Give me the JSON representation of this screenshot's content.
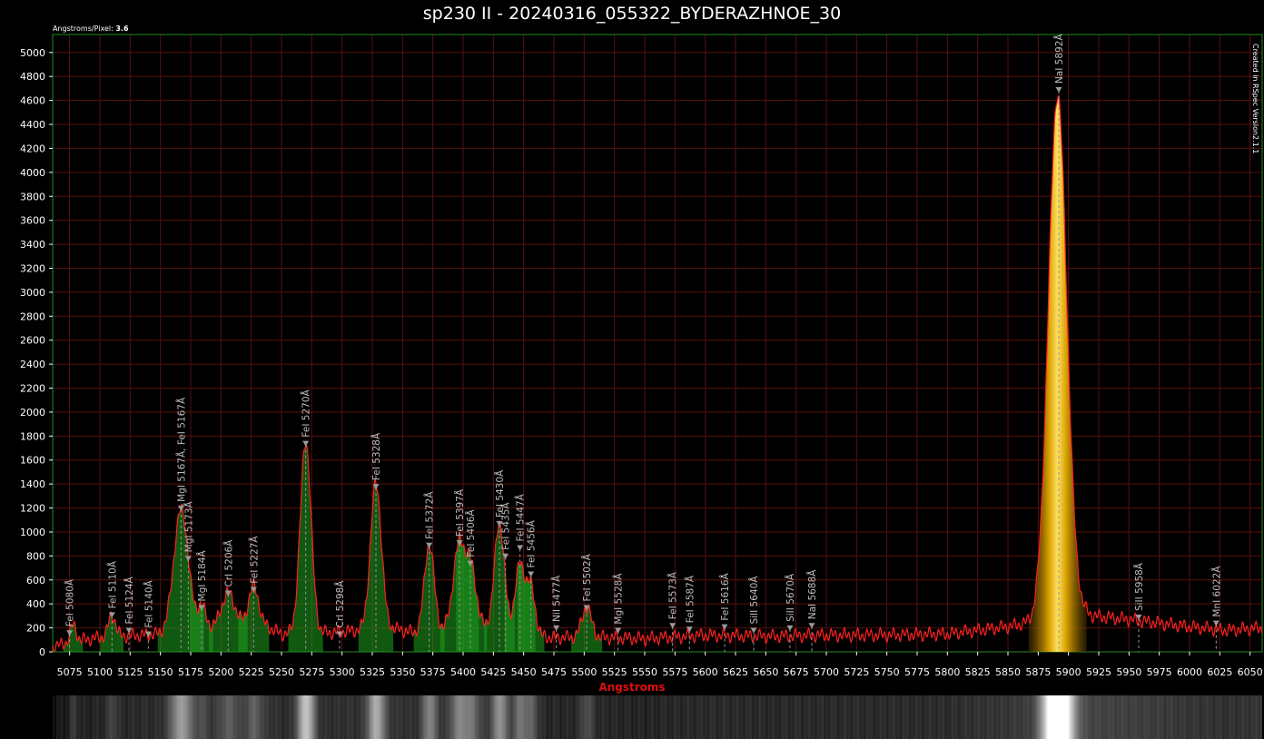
{
  "window": {
    "angstroms_per_pixel_label": "Angstroms/Pixel:",
    "angstroms_per_pixel_value": "3.6",
    "credit": "Created in RSpec Version2.1.1"
  },
  "colors": {
    "background": "#000000",
    "grid": "#5a1010",
    "plot_border": "#1f8a1f",
    "spectrum_line": "#ff2020",
    "peak_fill": "#1fa01f",
    "sodium_fill": "#f0c000",
    "axis_title": "#e01010",
    "marker": "#9a9a9a"
  },
  "chart_data": {
    "type": "line",
    "title": "sp230 II - 20240316_055322_BYDERAZHNOE_30",
    "xlabel": "Angstroms",
    "ylabel": "",
    "xlim": [
      5061,
      6060
    ],
    "ylim": [
      0,
      5150
    ],
    "grid": true,
    "x_ticks": [
      5075,
      5100,
      5125,
      5150,
      5175,
      5200,
      5225,
      5250,
      5275,
      5300,
      5325,
      5350,
      5375,
      5400,
      5425,
      5450,
      5475,
      5500,
      5525,
      5550,
      5575,
      5600,
      5625,
      5650,
      5675,
      5700,
      5725,
      5750,
      5775,
      5800,
      5825,
      5850,
      5875,
      5900,
      5925,
      5950,
      5975,
      6000,
      6025,
      6050
    ],
    "y_ticks": [
      0,
      200,
      400,
      600,
      800,
      1000,
      1200,
      1400,
      1600,
      1800,
      2000,
      2200,
      2400,
      2600,
      2800,
      3000,
      3200,
      3400,
      3600,
      3800,
      4000,
      4200,
      4400,
      4600,
      4800,
      5000
    ],
    "baseline": [
      [
        5061,
        40
      ],
      [
        5075,
        80
      ],
      [
        5100,
        120
      ],
      [
        5150,
        150
      ],
      [
        5200,
        230
      ],
      [
        5230,
        250
      ],
      [
        5250,
        150
      ],
      [
        5290,
        160
      ],
      [
        5340,
        200
      ],
      [
        5360,
        160
      ],
      [
        5420,
        220
      ],
      [
        5470,
        120
      ],
      [
        5520,
        120
      ],
      [
        5550,
        110
      ],
      [
        5600,
        140
      ],
      [
        5650,
        130
      ],
      [
        5700,
        140
      ],
      [
        5750,
        140
      ],
      [
        5800,
        150
      ],
      [
        5850,
        210
      ],
      [
        5870,
        250
      ],
      [
        5880,
        350
      ],
      [
        5900,
        400
      ],
      [
        5920,
        300
      ],
      [
        5950,
        270
      ],
      [
        5975,
        240
      ],
      [
        6000,
        210
      ],
      [
        6030,
        180
      ],
      [
        6060,
        200
      ]
    ],
    "peaks": [
      {
        "x": 5078,
        "y": 140,
        "w": 2.5
      },
      {
        "x": 5110,
        "y": 180,
        "w": 3
      },
      {
        "x": 5167,
        "y": 1010,
        "w": 6
      },
      {
        "x": 5184,
        "y": 180,
        "w": 3
      },
      {
        "x": 5206,
        "y": 260,
        "w": 5
      },
      {
        "x": 5227,
        "y": 300,
        "w": 4
      },
      {
        "x": 5270,
        "y": 1600,
        "w": 4.5
      },
      {
        "x": 5328,
        "y": 1220,
        "w": 4.5
      },
      {
        "x": 5372,
        "y": 730,
        "w": 4
      },
      {
        "x": 5397,
        "y": 720,
        "w": 5
      },
      {
        "x": 5407,
        "y": 450,
        "w": 4
      },
      {
        "x": 5430,
        "y": 880,
        "w": 4
      },
      {
        "x": 5447,
        "y": 560,
        "w": 4
      },
      {
        "x": 5456,
        "y": 380,
        "w": 3.5
      },
      {
        "x": 5502,
        "y": 250,
        "w": 4
      },
      {
        "x": 5891,
        "y": 4270,
        "w": 7.5
      }
    ],
    "markers": [
      {
        "x": 5075,
        "y": 150,
        "label": "FeI 5080Å"
      },
      {
        "x": 5110,
        "y": 300,
        "label": "FeI 5110Å"
      },
      {
        "x": 5124,
        "y": 170,
        "label": "FeI 5124Å"
      },
      {
        "x": 5140,
        "y": 140,
        "label": "FeI 5140Å"
      },
      {
        "x": 5167,
        "y": 1190,
        "label": "MgI 5167Å, FeI 5167Å"
      },
      {
        "x": 5173,
        "y": 770,
        "label": "MgI 5173Å"
      },
      {
        "x": 5184,
        "y": 360,
        "label": "MgI 5184Å"
      },
      {
        "x": 5206,
        "y": 480,
        "label": "CrI 5206Å"
      },
      {
        "x": 5227,
        "y": 510,
        "label": "FeI 5227Å"
      },
      {
        "x": 5270,
        "y": 1730,
        "label": "FeI 5270Å"
      },
      {
        "x": 5298,
        "y": 140,
        "label": "CrI 5298Å"
      },
      {
        "x": 5328,
        "y": 1370,
        "label": "FeI 5328Å"
      },
      {
        "x": 5372,
        "y": 880,
        "label": "FeI 5372Å"
      },
      {
        "x": 5397,
        "y": 900,
        "label": "FeI 5397Å"
      },
      {
        "x": 5406,
        "y": 730,
        "label": "FeI 5406Å"
      },
      {
        "x": 5430,
        "y": 1060,
        "label": "FeI 5430Å"
      },
      {
        "x": 5435,
        "y": 790,
        "label": "FeI 5435Å"
      },
      {
        "x": 5447,
        "y": 860,
        "label": "FeI 5447Å"
      },
      {
        "x": 5456,
        "y": 640,
        "label": "FeI 5456Å"
      },
      {
        "x": 5477,
        "y": 190,
        "label": "NiI 5477Å"
      },
      {
        "x": 5502,
        "y": 360,
        "label": "FeI 5502Å"
      },
      {
        "x": 5528,
        "y": 170,
        "label": "MgI 5528Å"
      },
      {
        "x": 5573,
        "y": 210,
        "label": "FeI 5573Å"
      },
      {
        "x": 5587,
        "y": 180,
        "label": "FeI 5587Å"
      },
      {
        "x": 5616,
        "y": 200,
        "label": "FeI 5616Å"
      },
      {
        "x": 5640,
        "y": 170,
        "label": "SiII 5640Å"
      },
      {
        "x": 5670,
        "y": 190,
        "label": "SiII 5670Å"
      },
      {
        "x": 5688,
        "y": 210,
        "label": "NaI 5688Å"
      },
      {
        "x": 5892,
        "y": 4680,
        "label": "NaI 5892Å"
      },
      {
        "x": 5958,
        "y": 280,
        "label": "SiII 5958Å"
      },
      {
        "x": 6022,
        "y": 230,
        "label": "MnI 6022Å"
      }
    ]
  }
}
